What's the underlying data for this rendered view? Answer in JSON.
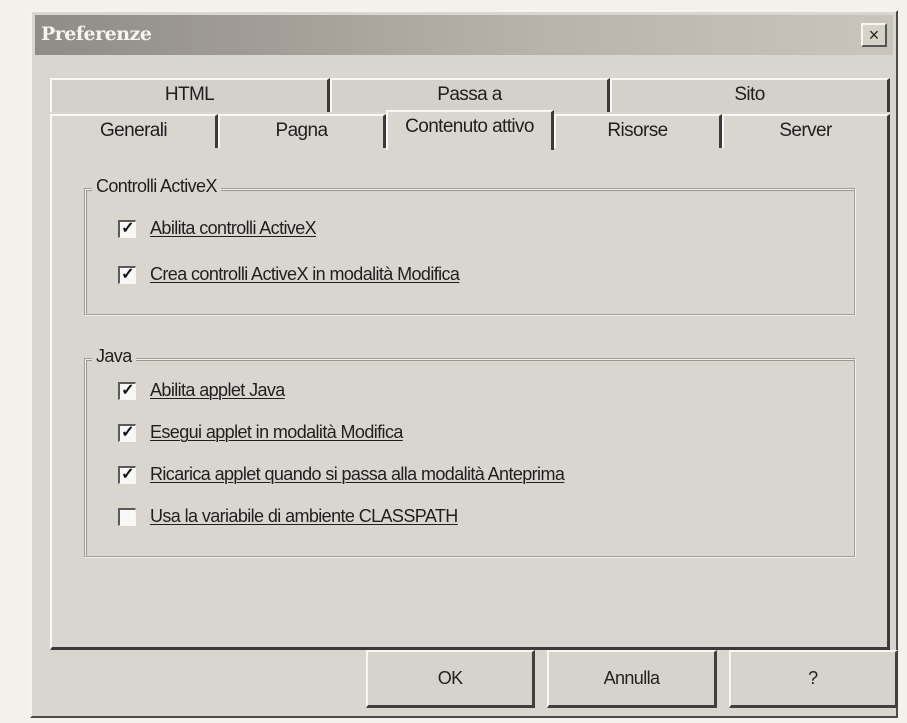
{
  "window": {
    "title": "Preferenze",
    "close_glyph": "×"
  },
  "tabs": {
    "back_row": [
      "HTML",
      "Passa a",
      "Sito"
    ],
    "front_row": [
      "Generali",
      "Pagna",
      "Contenuto attivo",
      "Risorse",
      "Server"
    ],
    "active": "Contenuto attivo"
  },
  "activex_group": {
    "legend": "Controlli ActiveX",
    "items": [
      {
        "label": "Abilita controlli ActiveX",
        "checked": true
      },
      {
        "label": "Crea controlli ActiveX in modalità Modifica",
        "checked": true
      }
    ]
  },
  "java_group": {
    "legend": "Java",
    "items": [
      {
        "label": "Abilita applet Java",
        "checked": true
      },
      {
        "label": "Esegui applet in modalità Modifica",
        "checked": true
      },
      {
        "label": "Ricarica applet quando si passa alla modalità Anteprima",
        "checked": true
      },
      {
        "label": "Usa la variabile di ambiente CLASSPATH",
        "checked": false
      }
    ]
  },
  "buttons": {
    "ok": "OK",
    "cancel": "Annulla",
    "help": "?"
  },
  "check_mark": "✓"
}
